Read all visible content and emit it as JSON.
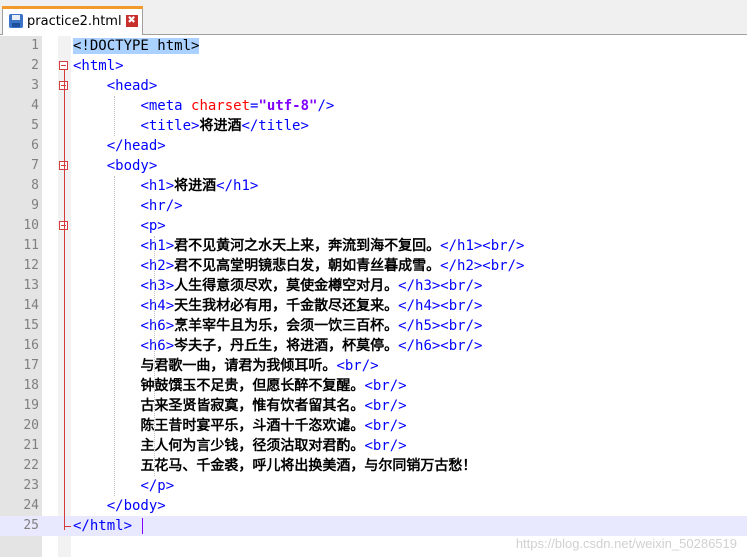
{
  "tab": {
    "filename": "practice2.html",
    "icon": "save-icon",
    "close_glyph": "✖"
  },
  "editor": {
    "lines": [
      {
        "n": "1",
        "tokens": [
          {
            "c": "hl",
            "t": "<!DOCTYPE html>"
          }
        ]
      },
      {
        "n": "2",
        "tokens": [
          {
            "c": "tag",
            "t": "<html>"
          }
        ]
      },
      {
        "n": "3",
        "tokens": [
          {
            "c": "",
            "t": "    "
          },
          {
            "c": "tag",
            "t": "<head>"
          }
        ]
      },
      {
        "n": "4",
        "tokens": [
          {
            "c": "",
            "t": "        "
          },
          {
            "c": "tag",
            "t": "<meta "
          },
          {
            "c": "attr",
            "t": "charset"
          },
          {
            "c": "tag",
            "t": "="
          },
          {
            "c": "val",
            "t": "\"utf-8\""
          },
          {
            "c": "tag",
            "t": "/>"
          }
        ]
      },
      {
        "n": "5",
        "tokens": [
          {
            "c": "",
            "t": "        "
          },
          {
            "c": "tag",
            "t": "<title>"
          },
          {
            "c": "txt",
            "t": "将进酒"
          },
          {
            "c": "tag",
            "t": "</title>"
          }
        ]
      },
      {
        "n": "6",
        "tokens": [
          {
            "c": "",
            "t": "    "
          },
          {
            "c": "tag",
            "t": "</head>"
          }
        ]
      },
      {
        "n": "7",
        "tokens": [
          {
            "c": "",
            "t": "    "
          },
          {
            "c": "tag",
            "t": "<body>"
          }
        ]
      },
      {
        "n": "8",
        "tokens": [
          {
            "c": "",
            "t": "        "
          },
          {
            "c": "tag",
            "t": "<h1>"
          },
          {
            "c": "txt",
            "t": "将进酒"
          },
          {
            "c": "tag",
            "t": "</h1>"
          }
        ]
      },
      {
        "n": "9",
        "tokens": [
          {
            "c": "",
            "t": "        "
          },
          {
            "c": "tag",
            "t": "<hr/>"
          }
        ]
      },
      {
        "n": "10",
        "tokens": [
          {
            "c": "",
            "t": "        "
          },
          {
            "c": "tag",
            "t": "<p>"
          }
        ]
      },
      {
        "n": "11",
        "tokens": [
          {
            "c": "",
            "t": "        "
          },
          {
            "c": "tag",
            "t": "<h1>"
          },
          {
            "c": "txt",
            "t": "君不见黄河之水天上来，奔流到海不复回。"
          },
          {
            "c": "tag",
            "t": "</h1><br/>"
          }
        ]
      },
      {
        "n": "12",
        "tokens": [
          {
            "c": "",
            "t": "        "
          },
          {
            "c": "tag",
            "t": "<h2>"
          },
          {
            "c": "txt",
            "t": "君不见高堂明镜悲白发，朝如青丝暮成雪。"
          },
          {
            "c": "tag",
            "t": "</h2><br/>"
          }
        ]
      },
      {
        "n": "13",
        "tokens": [
          {
            "c": "",
            "t": "        "
          },
          {
            "c": "tag",
            "t": "<h3>"
          },
          {
            "c": "txt",
            "t": "人生得意须尽欢，莫使金樽空对月。"
          },
          {
            "c": "tag",
            "t": "</h3><br/>"
          }
        ]
      },
      {
        "n": "14",
        "tokens": [
          {
            "c": "",
            "t": "        "
          },
          {
            "c": "tag",
            "t": "<h4>"
          },
          {
            "c": "txt",
            "t": "天生我材必有用，千金散尽还复来。"
          },
          {
            "c": "tag",
            "t": "</h4><br/>"
          }
        ]
      },
      {
        "n": "15",
        "tokens": [
          {
            "c": "",
            "t": "        "
          },
          {
            "c": "tag",
            "t": "<h6>"
          },
          {
            "c": "txt",
            "t": "烹羊宰牛且为乐，会须一饮三百杯。"
          },
          {
            "c": "tag",
            "t": "</h5><br/>"
          }
        ]
      },
      {
        "n": "16",
        "tokens": [
          {
            "c": "",
            "t": "        "
          },
          {
            "c": "tag",
            "t": "<h6>"
          },
          {
            "c": "txt",
            "t": "岑夫子，丹丘生，将进酒，杯莫停。"
          },
          {
            "c": "tag",
            "t": "</h6><br/>"
          }
        ]
      },
      {
        "n": "17",
        "tokens": [
          {
            "c": "",
            "t": "        "
          },
          {
            "c": "txt",
            "t": "与君歌一曲，请君为我倾耳听。"
          },
          {
            "c": "tag",
            "t": "<br/>"
          }
        ]
      },
      {
        "n": "18",
        "tokens": [
          {
            "c": "",
            "t": "        "
          },
          {
            "c": "txt",
            "t": "钟鼓馔玉不足贵，但愿长醉不复醒。"
          },
          {
            "c": "tag",
            "t": "<br/>"
          }
        ]
      },
      {
        "n": "19",
        "tokens": [
          {
            "c": "",
            "t": "        "
          },
          {
            "c": "txt",
            "t": "古来圣贤皆寂寞，惟有饮者留其名。"
          },
          {
            "c": "tag",
            "t": "<br/>"
          }
        ]
      },
      {
        "n": "20",
        "tokens": [
          {
            "c": "",
            "t": "        "
          },
          {
            "c": "txt",
            "t": "陈王昔时宴平乐，斗酒十千恣欢谑。"
          },
          {
            "c": "tag",
            "t": "<br/>"
          }
        ]
      },
      {
        "n": "21",
        "tokens": [
          {
            "c": "",
            "t": "        "
          },
          {
            "c": "txt",
            "t": "主人何为言少钱，径须沽取对君酌。"
          },
          {
            "c": "tag",
            "t": "<br/>"
          }
        ]
      },
      {
        "n": "22",
        "tokens": [
          {
            "c": "",
            "t": "        "
          },
          {
            "c": "txt",
            "t": "五花马、千金裘，呼儿将出换美酒，与尔同销万古愁！"
          }
        ]
      },
      {
        "n": "23",
        "tokens": [
          {
            "c": "",
            "t": "        "
          },
          {
            "c": "tag",
            "t": "</p>"
          }
        ]
      },
      {
        "n": "24",
        "tokens": [
          {
            "c": "",
            "t": "    "
          },
          {
            "c": "tag",
            "t": "</body>"
          }
        ]
      },
      {
        "n": "25",
        "tokens": [
          {
            "c": "tag",
            "t": "</html>"
          }
        ]
      }
    ]
  },
  "watermark": "https://blog.csdn.net/weixin_50286519"
}
